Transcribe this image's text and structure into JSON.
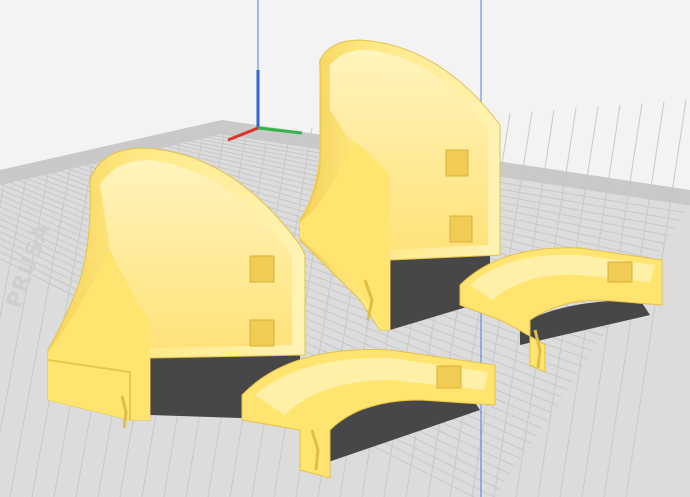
{
  "scene": {
    "bed_label": "PRUSA",
    "colors": {
      "background": "#f3f3f3",
      "bed_surface": "#dcdcdc",
      "bed_edge": "#bdbdbd",
      "grid_line": "#c8c8c8",
      "model_fill": "#ffe680",
      "model_light": "#fff0a8",
      "model_shade": "#f2cf52",
      "shadow": "#4b4b4b",
      "axis_x": "#e0302c",
      "axis_y": "#35b34a",
      "axis_z": "#2f67d8",
      "guide_line": "#4a7fe0"
    },
    "axes": [
      "x-axis",
      "y-axis",
      "z-axis"
    ],
    "objects": [
      {
        "id": "tall-part-left",
        "kind": "curved-shell-tall"
      },
      {
        "id": "tall-part-back",
        "kind": "curved-shell-tall"
      },
      {
        "id": "ring-part-front",
        "kind": "half-ring-clip"
      },
      {
        "id": "ring-part-right",
        "kind": "half-ring-clip"
      }
    ]
  }
}
